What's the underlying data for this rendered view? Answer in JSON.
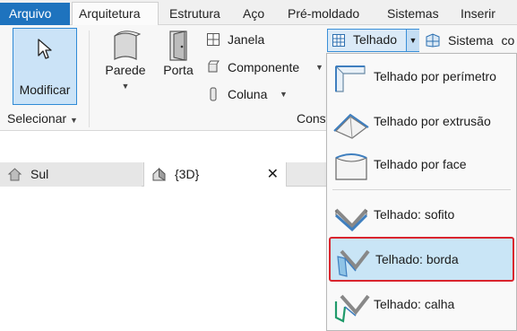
{
  "tabs": {
    "file": "Arquivo",
    "items": [
      "Arquitetura",
      "Estrutura",
      "Aço",
      "Pré-moldado",
      "Sistemas",
      "Inserir"
    ]
  },
  "ribbon": {
    "modify_label": "Modificar",
    "select_label": "Selecionar",
    "wall_label": "Parede",
    "door_label": "Porta",
    "window_label": "Janela",
    "component_label": "Componente",
    "column_label": "Coluna",
    "build_group_label": "Const",
    "roof_label": "Telhado",
    "system_label": "Sistema",
    "system_overflow": "co"
  },
  "views": {
    "south_label": "Sul",
    "three_d_label": "{3D}",
    "close_glyph": "✕"
  },
  "roof_menu": {
    "items": [
      {
        "label": "Telhado por perímetro",
        "icon": "roof-footprint-icon"
      },
      {
        "label": "Telhado por extrusão",
        "icon": "roof-extrusion-icon"
      },
      {
        "label": "Telhado por face",
        "icon": "roof-face-icon"
      },
      {
        "label": "Telhado: sofito",
        "icon": "roof-soffit-icon"
      },
      {
        "label": "Telhado: borda",
        "icon": "roof-fascia-icon",
        "highlighted": true
      },
      {
        "label": "Telhado: calha",
        "icon": "roof-gutter-icon"
      }
    ]
  },
  "colors": {
    "file_tab": "#1e73be",
    "selected_tool": "#cbe3f7",
    "highlight_border": "#d9252e",
    "highlight_fill": "#c9e5f6"
  }
}
